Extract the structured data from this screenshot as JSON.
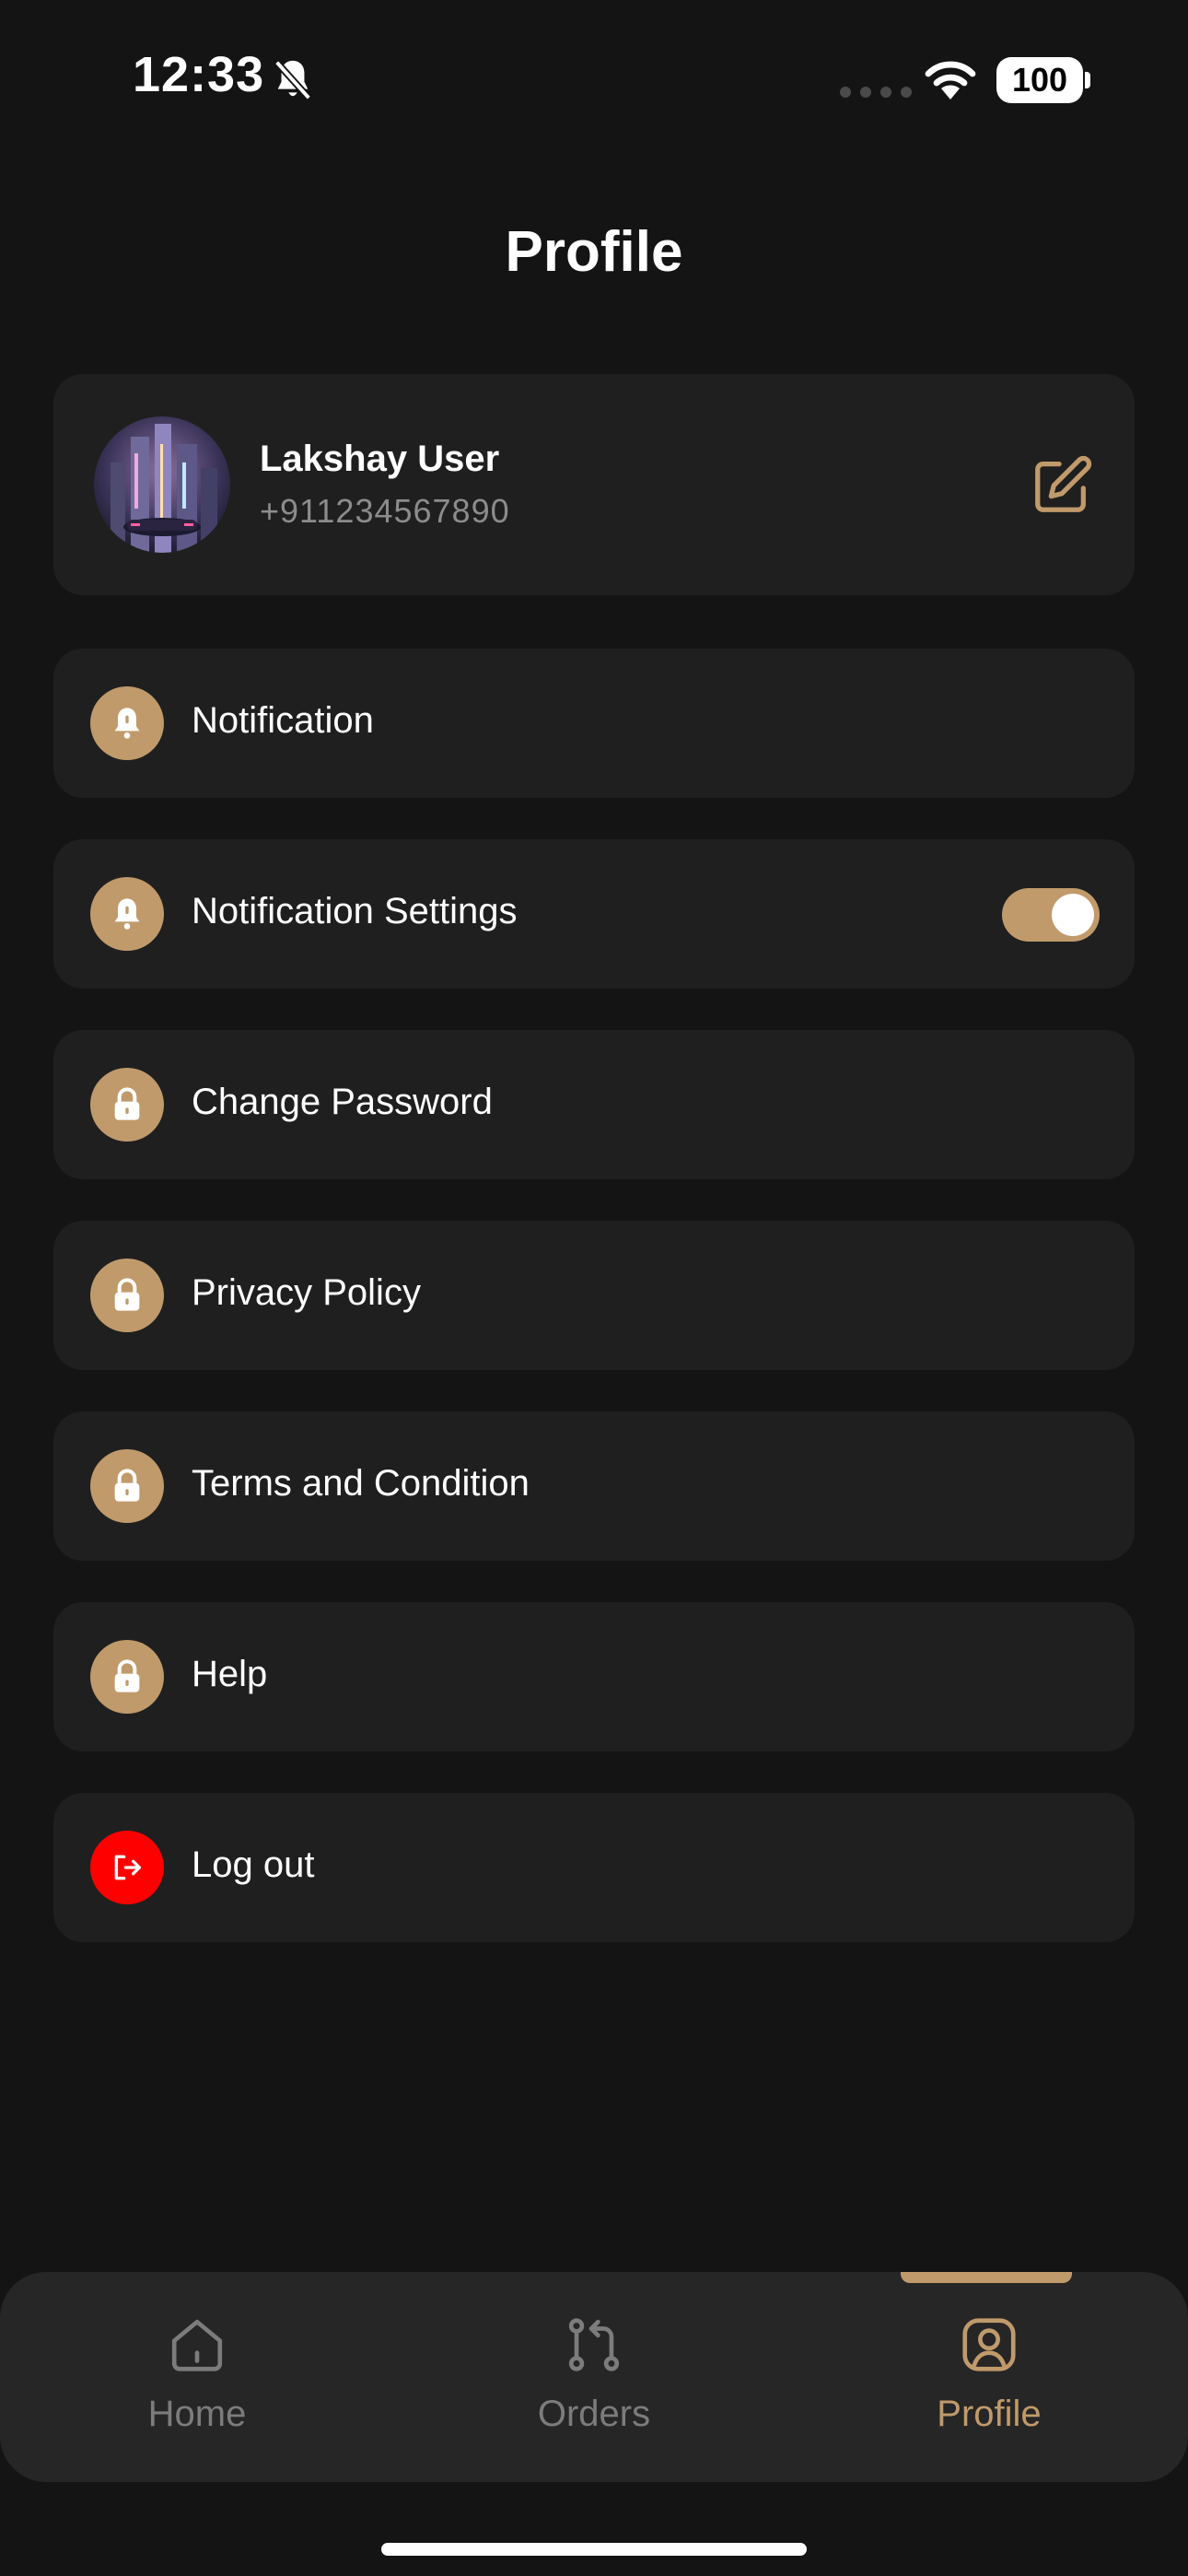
{
  "status_bar": {
    "time": "12:33",
    "battery": "100"
  },
  "header": {
    "title": "Profile"
  },
  "profile": {
    "name": "Lakshay User",
    "phone": "+911234567890"
  },
  "menu": [
    {
      "label": "Notification",
      "icon": "bell-icon"
    },
    {
      "label": "Notification Settings",
      "icon": "bell-icon",
      "toggle_on": true
    },
    {
      "label": "Change Password",
      "icon": "lock-icon"
    },
    {
      "label": "Privacy Policy",
      "icon": "lock-icon"
    },
    {
      "label": "Terms and Condition",
      "icon": "lock-icon"
    },
    {
      "label": "Help",
      "icon": "lock-icon"
    },
    {
      "label": "Log out",
      "icon": "logout-icon"
    }
  ],
  "bottom_nav": [
    {
      "label": "Home",
      "icon": "home-icon",
      "active": false
    },
    {
      "label": "Orders",
      "icon": "git-compare-icon",
      "active": false
    },
    {
      "label": "Profile",
      "icon": "user-icon",
      "active": true
    }
  ],
  "colors": {
    "background": "#141414",
    "card": "#1f1f1f",
    "accent": "#c19a6b",
    "logout": "#ff0000",
    "nav_bg": "#262626"
  }
}
